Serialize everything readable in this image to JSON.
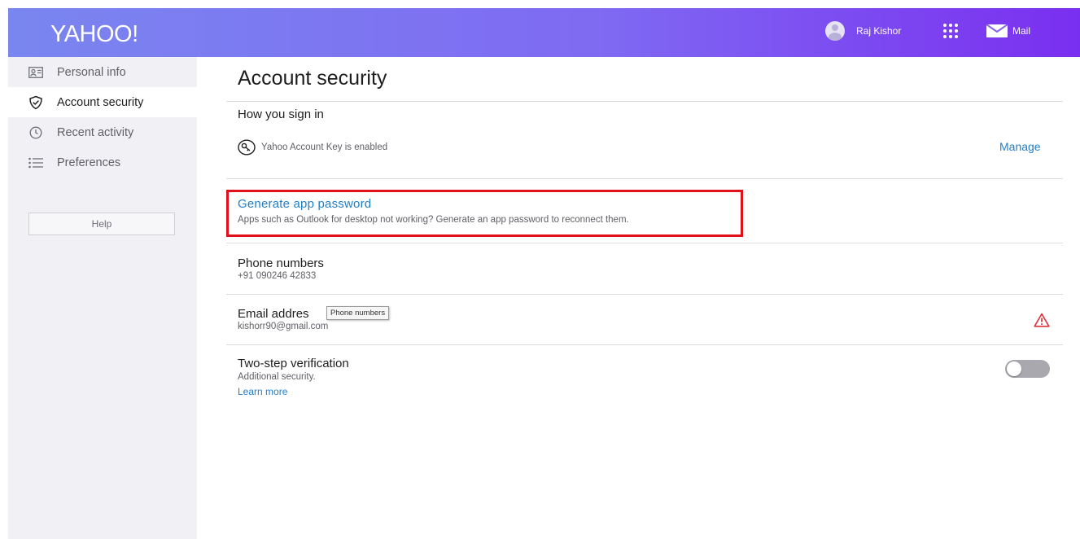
{
  "header": {
    "logo": "YAHOO!",
    "user_name": "Raj Kishor",
    "mail_label": "Mail",
    "gradient_colors": [
      "#7a86f0",
      "#7f6af2",
      "#7a2ff0"
    ]
  },
  "sidebar": {
    "items": [
      {
        "label": "Personal info",
        "icon": "id-card-icon",
        "active": false
      },
      {
        "label": "Account security",
        "icon": "shield-check-icon",
        "active": true
      },
      {
        "label": "Recent activity",
        "icon": "clock-icon",
        "active": false
      },
      {
        "label": "Preferences",
        "icon": "list-icon",
        "active": false
      }
    ],
    "help_label": "Help"
  },
  "main": {
    "title": "Account security",
    "how_you_sign_in": {
      "heading": "How you sign in",
      "key_status": "Yahoo Account Key is enabled",
      "manage_label": "Manage"
    },
    "app_password": {
      "link": "Generate app password",
      "description": "Apps such as Outlook for desktop not working? Generate an app password to reconnect them."
    },
    "phone": {
      "heading": "Phone numbers",
      "value": "+91 090246 42833"
    },
    "email": {
      "heading": "Email addres",
      "value": "kishorr90@gmail.com",
      "tooltip": "Phone numbers",
      "status": "warning-icon"
    },
    "two_step": {
      "heading": "Two-step verification",
      "description": "Additional security.",
      "learn_more": "Learn more",
      "enabled": false
    }
  },
  "colors": {
    "link": "#1f7ecb",
    "highlight": "#e3101c",
    "warning": "#e0303a",
    "sidebar_bg": "#f1f1f5"
  }
}
